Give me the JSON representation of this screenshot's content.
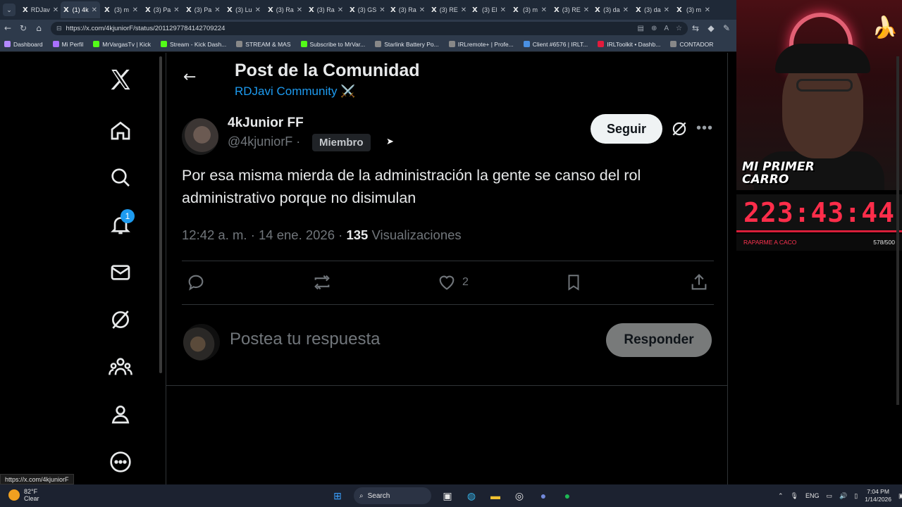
{
  "browser": {
    "tabs": [
      "RDJav",
      "(1) 4k",
      "(3) m",
      "(3) Pa",
      "(3) Pa",
      "(3) Lu",
      "(3) Ra",
      "(3) Ra",
      "(3) GS",
      "(3) Ra",
      "(3) RE",
      "(3) El",
      "(3) m",
      "(3) RE",
      "(3) da",
      "(3) da",
      "(3) m"
    ],
    "url": "https://x.com/4kjuniorF/status/2011297784142709224",
    "bookmarks": [
      "Dashboard",
      "Mi Perfil",
      "MrVargasTv | Kick",
      "Stream - Kick Dash...",
      "STREAM & MAS",
      "Subscribe to MrVar...",
      "Starlink Battery Po...",
      "IRLremote+ | Profe...",
      "Client #6576 | IRLT...",
      "IRLToolkit • Dashb...",
      "CONTADOR"
    ],
    "bookmark_colors": [
      "#b388ff",
      "#a970ff",
      "#53fc18",
      "#53fc18",
      "#888888",
      "#53fc18",
      "#888888",
      "#888888",
      "#4a90e2",
      "#e21b3c",
      "#888888"
    ]
  },
  "x_nav": {
    "notifications_badge": "1"
  },
  "post": {
    "page_title": "Post de la Comunidad",
    "community": "RDJavi Community ⚔️",
    "display_name": "4kJunior FF",
    "handle": "@4kjuniorF ·",
    "member_badge": "Miembro",
    "follow_label": "Seguir",
    "text": "Por esa misma mierda de la administración la gente se canso del rol administrativo porque no disimulan",
    "timestamp": "12:42 a. m. · 14 ene. 2026 · ",
    "views_count": "135",
    "views_label": " Visualizaciones",
    "like_count": "2",
    "reply_placeholder": "Postea tu respuesta",
    "reply_button": "Responder"
  },
  "status_url": "https://x.com/4kjuniorF",
  "overlay": {
    "sticker": "MI PRIMER CARRO",
    "timer": "223:43:44",
    "goal_label": "RAPARME A CACO",
    "goal_count": "578/500"
  },
  "taskbar": {
    "temp": "82°F",
    "weather": "Clear",
    "search": "Search",
    "lang": "ENG",
    "time": "7:04 PM",
    "date": "1/14/2026"
  },
  "colors": {
    "accent": "#1d9bf0",
    "timer": "#ff2d4a"
  }
}
